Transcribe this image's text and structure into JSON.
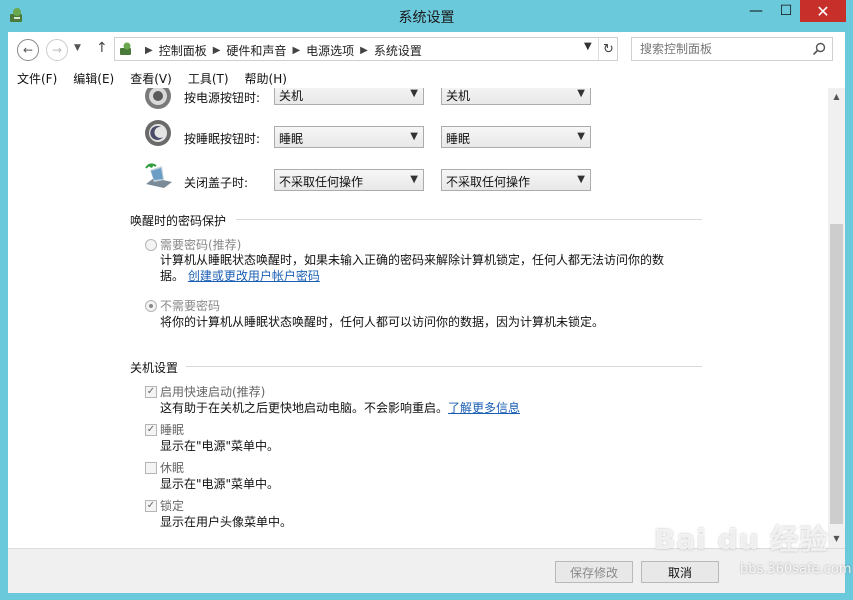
{
  "window": {
    "title": "系统设置",
    "minimize": "—",
    "maximize": "☐",
    "close": "✕"
  },
  "nav": {
    "breadcrumb": [
      "控制面板",
      "硬件和声音",
      "电源选项",
      "系统设置"
    ],
    "search_placeholder": "搜索控制面板"
  },
  "menu": [
    "文件(F)",
    "编辑(E)",
    "查看(V)",
    "工具(T)",
    "帮助(H)"
  ],
  "power_buttons": [
    {
      "label": "按电源按钮时:",
      "battery": "关机",
      "plugged": "关机"
    },
    {
      "label": "按睡眠按钮时:",
      "battery": "睡眠",
      "plugged": "睡眠"
    },
    {
      "label": "关闭盖子时:",
      "battery": "不采取任何操作",
      "plugged": "不采取任何操作"
    }
  ],
  "wake_password": {
    "heading": "唤醒时的密码保护",
    "require": {
      "label": "需要密码(推荐)",
      "desc": "计算机从睡眠状态唤醒时，如果未输入正确的密码来解除计算机锁定，任何人都无法访问你的数",
      "desc2": "据。",
      "link": "创建或更改用户帐户密码",
      "selected": false
    },
    "no_require": {
      "label": "不需要密码",
      "desc": "将你的计算机从睡眠状态唤醒时，任何人都可以访问你的数据，因为计算机未锁定。",
      "selected": true
    }
  },
  "shutdown": {
    "heading": "关机设置",
    "items": [
      {
        "label": "启用快速启动(推荐)",
        "desc": "这有助于在关机之后更快地启动电脑。不会影响重启。",
        "link": "了解更多信息",
        "checked": true
      },
      {
        "label": "睡眠",
        "desc": "显示在\"电源\"菜单中。",
        "checked": true
      },
      {
        "label": "休眠",
        "desc": "显示在\"电源\"菜单中。",
        "checked": false
      },
      {
        "label": "锁定",
        "desc": "显示在用户头像菜单中。",
        "checked": true
      }
    ]
  },
  "footer": {
    "save": "保存修改",
    "cancel": "取消"
  },
  "watermark": {
    "brand": "Bai du 经验",
    "sub": "bbs.360safe.com"
  },
  "colors": {
    "titlebar": "#6bc9dc",
    "close": "#c7302a",
    "link": "#1a5fb4"
  }
}
